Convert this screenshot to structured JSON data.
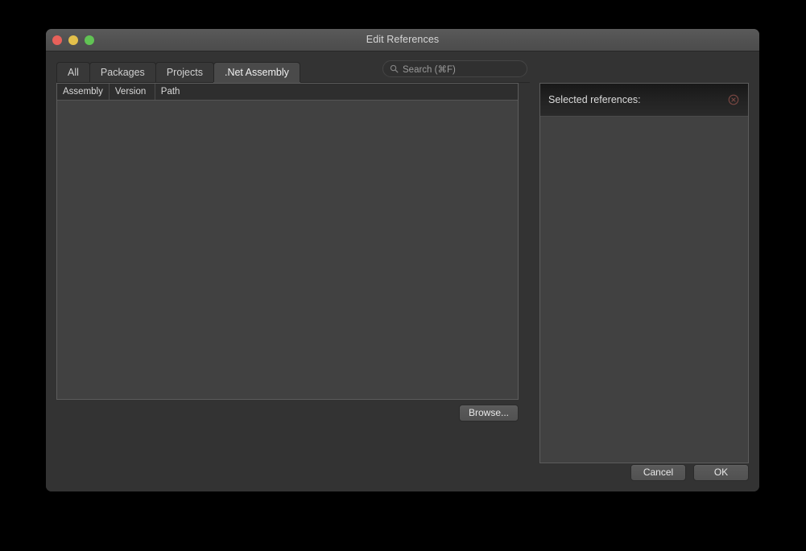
{
  "window": {
    "title": "Edit References",
    "traffic_lights": [
      {
        "name": "close",
        "color": "#e8615a"
      },
      {
        "name": "minimize",
        "color": "#e3c04b"
      },
      {
        "name": "zoom",
        "color": "#61c354"
      }
    ]
  },
  "tabs": [
    {
      "label": "All",
      "active": false
    },
    {
      "label": "Packages",
      "active": false
    },
    {
      "label": "Projects",
      "active": false
    },
    {
      "label": ".Net Assembly",
      "active": true
    }
  ],
  "search": {
    "placeholder": "Search (⌘F)",
    "value": "",
    "icon": "search-icon"
  },
  "table": {
    "columns": [
      "Assembly",
      "Version",
      "Path"
    ],
    "rows": []
  },
  "left_actions": {
    "browse_label": "Browse..."
  },
  "selected_panel": {
    "title": "Selected references:",
    "clear_icon": "circle-x-icon",
    "clear_icon_color": "#7a4742",
    "items": []
  },
  "footer": {
    "cancel_label": "Cancel",
    "ok_label": "OK"
  },
  "colors": {
    "desktop": "#000000",
    "window_body": "#333333",
    "titlebar": "#525252",
    "pane_background": "#414141",
    "pane_border": "#5c5c5c",
    "active_tab": "#4a4a4a",
    "inactive_tab": "#383838",
    "text_primary": "#e8e8e8",
    "text_secondary": "#9a9a9a"
  }
}
